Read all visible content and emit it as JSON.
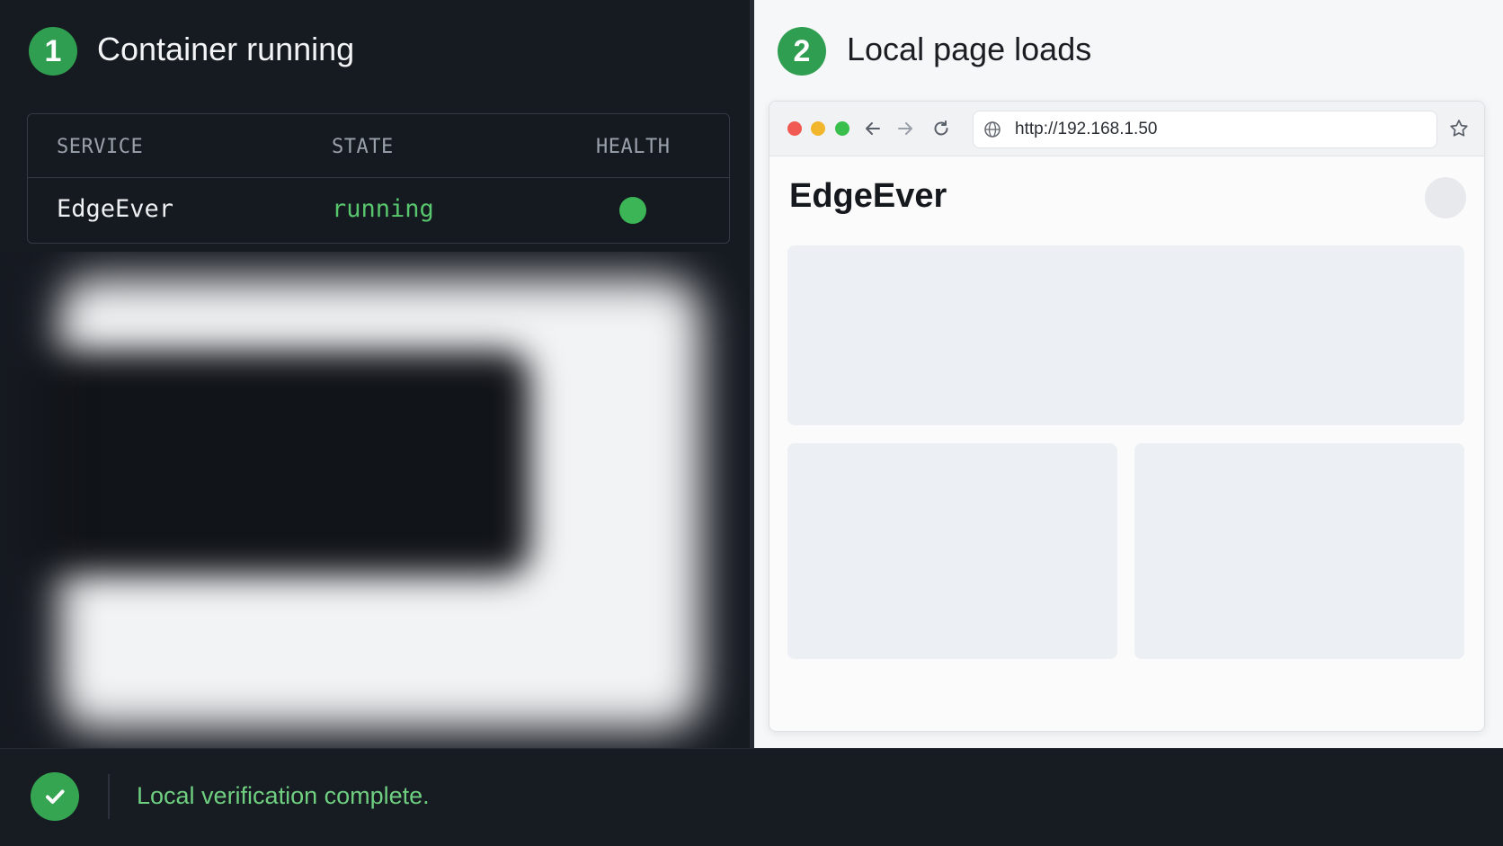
{
  "left_panel": {
    "step_number": "1",
    "title": "Container running",
    "table": {
      "headers": [
        "SERVICE",
        "STATE",
        "HEALTH"
      ],
      "rows": [
        {
          "service": "EdgeEver",
          "state": "running",
          "health_color": "#3bb556"
        }
      ]
    }
  },
  "right_panel": {
    "step_number": "2",
    "title": "Local page loads",
    "browser": {
      "url": "http://192.168.1.50",
      "page_title": "EdgeEver",
      "icons": [
        "back-arrow-icon",
        "forward-arrow-icon",
        "reload-icon",
        "globe-icon",
        "star-icon"
      ]
    }
  },
  "status_bar": {
    "icon": "check-icon",
    "message": "Local verification complete."
  },
  "colors": {
    "accent_green": "#2f9e50",
    "running_text": "#58c66d",
    "status_text": "#6fcf80",
    "dark_bg": "#161a21"
  }
}
